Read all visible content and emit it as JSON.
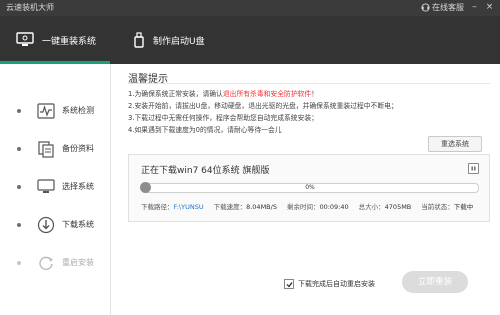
{
  "app": {
    "title": "云速装机大师",
    "support_label": "在线客服",
    "colors": {
      "accent": "#18a07b",
      "topbar": "#333333",
      "titlebar": "#3b3b3b"
    }
  },
  "tabs": [
    {
      "label": "一键重装系统",
      "icon": "monitor-icon"
    },
    {
      "label": "制作启动U盘",
      "icon": "usb-drive-icon"
    }
  ],
  "sidebar": {
    "steps": [
      {
        "label": "系统检测",
        "icon": "pulse-icon"
      },
      {
        "label": "备份资料",
        "icon": "copy-icon"
      },
      {
        "label": "选择系统",
        "icon": "monitor-icon"
      },
      {
        "label": "下载系统",
        "icon": "download-icon"
      },
      {
        "label": "重启安装",
        "icon": "refresh-icon"
      }
    ]
  },
  "main": {
    "title": "温馨提示",
    "notes": [
      {
        "before": "1.为确保系统正常安装，请确认",
        "highlight": "退出所有杀毒和安全防护软件",
        "after": "！"
      },
      {
        "before": "2.安装开始前，请拔出U盘，移动硬盘，退出光驱的光盘，并确保系统重装过程中不断电；",
        "highlight": "",
        "after": ""
      },
      {
        "before": "3.下载过程中无需任何操作，程序会帮助您自动完成系统安装；",
        "highlight": "",
        "after": ""
      },
      {
        "before": "4.如果遇到下载速度为0的情况，请耐心等待一会儿",
        "highlight": "",
        "after": ""
      }
    ],
    "switch_system_label": "重选系统",
    "download": {
      "title": "正在下载win7 64位系统 旗舰版",
      "progress_percent": 0,
      "progress_label": "0%",
      "stats": [
        {
          "label": "下载路径：",
          "value": "F:\\YUNSU",
          "style": "path"
        },
        {
          "label": "下载速度：",
          "value": "8.04MB/S",
          "style": "val"
        },
        {
          "label": "剩余时间：",
          "value": "00:09:40",
          "style": "val"
        },
        {
          "label": "总大小：",
          "value": "4705MB",
          "style": "val"
        },
        {
          "label": "当前状态：",
          "value": "下载中",
          "style": "val"
        }
      ]
    },
    "auto_install_label": "下载完成后自动重启安装",
    "auto_install_checked": true,
    "install_button_label": "立即重装"
  }
}
